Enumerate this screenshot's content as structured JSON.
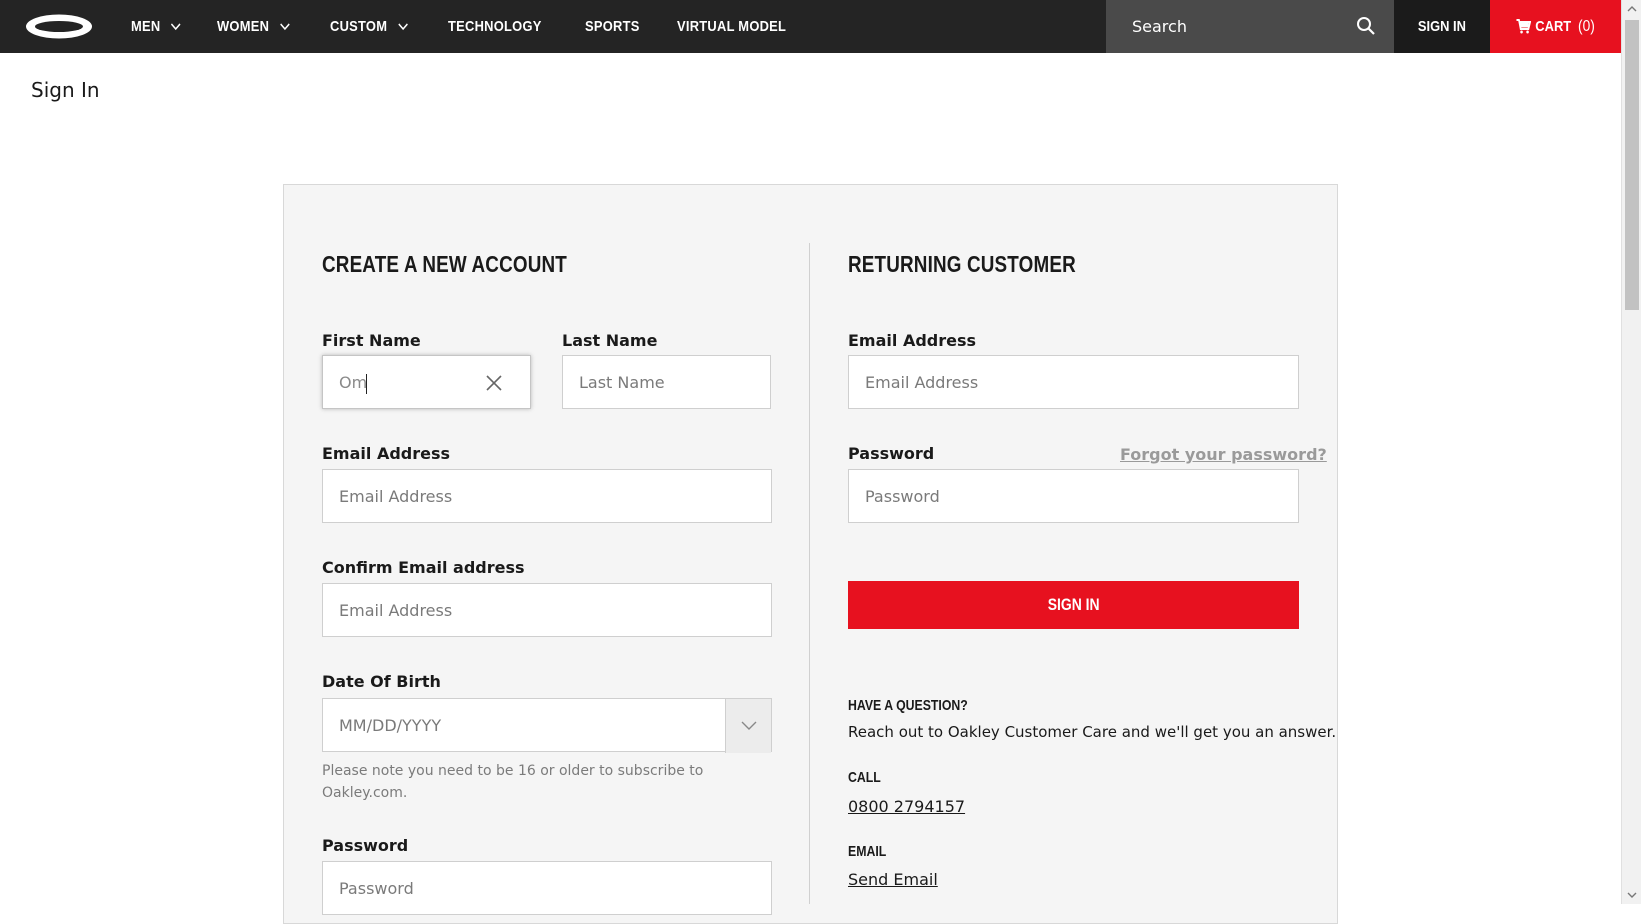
{
  "header": {
    "logo": "oakley-ellipse-logo",
    "nav": [
      {
        "label": "MEN",
        "has_dropdown": true
      },
      {
        "label": "WOMEN",
        "has_dropdown": true
      },
      {
        "label": "CUSTOM",
        "has_dropdown": true
      },
      {
        "label": "TECHNOLOGY",
        "has_dropdown": false
      },
      {
        "label": "SPORTS",
        "has_dropdown": false
      },
      {
        "label": "VIRTUAL MODEL",
        "has_dropdown": false
      }
    ],
    "search_placeholder": "Search",
    "search_icon": "magnifier-icon",
    "sign_in_label": "SIGN IN",
    "cart_label": "CART",
    "cart_count": "(0)",
    "cart_icon": "shopping-cart-icon"
  },
  "page_title": "Sign In",
  "create_account": {
    "title": "CREATE A NEW ACCOUNT",
    "first_name": {
      "label": "First Name",
      "value": "Om"
    },
    "last_name": {
      "label": "Last Name",
      "placeholder": "Last Name"
    },
    "email": {
      "label": "Email Address",
      "placeholder": "Email Address"
    },
    "confirm_email": {
      "label": "Confirm Email address",
      "placeholder": "Email Address"
    },
    "dob": {
      "label": "Date Of Birth",
      "placeholder": "MM/DD/YYYY"
    },
    "dob_note": "Please note you need to be 16 or older to subscribe to Oakley.com.",
    "password": {
      "label": "Password",
      "placeholder": "Password"
    }
  },
  "returning": {
    "title": "RETURNING CUSTOMER",
    "email": {
      "label": "Email Address",
      "placeholder": "Email Address"
    },
    "password": {
      "label": "Password",
      "placeholder": "Password"
    },
    "forgot_label": "Forgot your password?",
    "sign_in_button": "SIGN IN",
    "question_heading": "HAVE A QUESTION?",
    "question_text": "Reach out to Oakley Customer Care and we'll get you an answer.",
    "call_heading": "CALL",
    "phone": "0800 2794157",
    "email_heading": "EMAIL",
    "send_email": "Send Email"
  },
  "colors": {
    "accent_red": "#e7111f",
    "nav_bg": "#242424",
    "panel_bg": "#f5f5f5"
  }
}
